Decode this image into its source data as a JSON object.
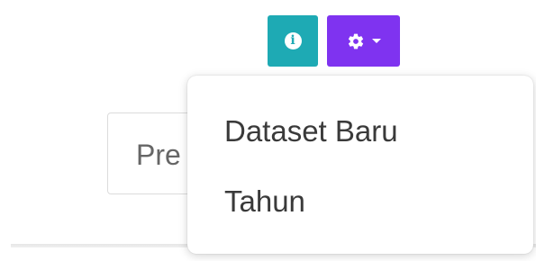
{
  "toolbar": {
    "info_icon": "info-icon",
    "info_glyph": "i",
    "settings_icon": "gear-icon",
    "caret_icon": "chevron-down-icon",
    "info_color": "#1eaab4",
    "settings_color": "#7f33f0"
  },
  "search": {
    "value": "Pre"
  },
  "dropdown": {
    "items": [
      {
        "label": "Dataset Baru"
      },
      {
        "label": "Tahun"
      }
    ]
  }
}
